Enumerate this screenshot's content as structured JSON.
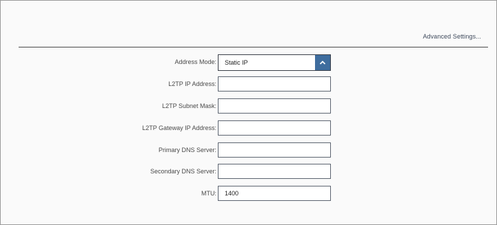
{
  "header": {
    "advanced_settings_label": "Advanced Settings..."
  },
  "form": {
    "address_mode": {
      "label": "Address Mode:",
      "value": "Static IP",
      "icon": "chevron-up-icon"
    },
    "l2tp_ip_address": {
      "label": "L2TP IP Address:",
      "value": ""
    },
    "l2tp_subnet_mask": {
      "label": "L2TP Subnet Mask:",
      "value": ""
    },
    "l2tp_gateway_ip": {
      "label": "L2TP Gateway IP Address:",
      "value": ""
    },
    "primary_dns": {
      "label": "Primary DNS Server:",
      "value": ""
    },
    "secondary_dns": {
      "label": "Secondary DNS Server:",
      "value": ""
    },
    "mtu": {
      "label": "MTU:",
      "value": "1400"
    }
  },
  "colors": {
    "accent": "#3f6d9e",
    "field_border": "#5c6470",
    "label_text": "#4a4a4a"
  }
}
